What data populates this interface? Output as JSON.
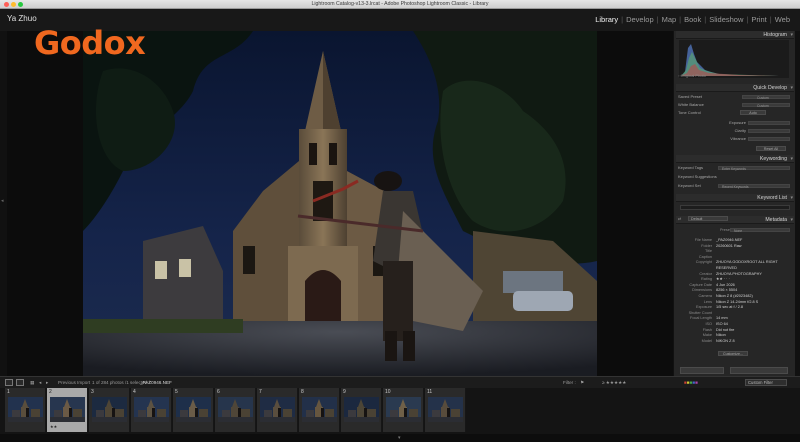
{
  "window": {
    "title": "Lightroom Catalog-v13-3.lrcat - Adobe Photoshop Lightroom Classic - Library"
  },
  "identity": {
    "name": "Ya Zhuo"
  },
  "modules": [
    "Library",
    "Develop",
    "Map",
    "Book",
    "Slideshow",
    "Print",
    "Web"
  ],
  "active_module": "Library",
  "logo": {
    "text": "Godox",
    "color": "#f0681f"
  },
  "right_panel": {
    "histogram": {
      "title": "Histogram",
      "original_photo_label": "Original Photo"
    },
    "quick_develop": {
      "title": "Quick Develop",
      "rows": [
        {
          "label": "Saved Preset",
          "value": "Custom"
        },
        {
          "label": "White Balance",
          "value": "Custom"
        },
        {
          "label": "Tone Control",
          "value": "Auto"
        },
        {
          "label": "Exposure",
          "value": ""
        },
        {
          "label": "Clarity",
          "value": ""
        },
        {
          "label": "Vibrance",
          "value": ""
        }
      ],
      "reset_label": "Reset All"
    },
    "keywording": {
      "title": "Keywording",
      "rows": [
        {
          "label": "Keyword Tags",
          "value": "Enter Keywords"
        },
        {
          "label": "Keyword Suggestions",
          "value": ""
        },
        {
          "label": "Keyword Set",
          "value": "Recent Keywords"
        }
      ]
    },
    "keyword_list": {
      "title": "Keyword List"
    },
    "metadata": {
      "title": "Metadata",
      "preset_label": "Default",
      "preset_value": "None",
      "fields": [
        {
          "key": "File Name",
          "value": "_PAZ0946.NEF"
        },
        {
          "key": "Folder",
          "value": "20260601 Raw"
        },
        {
          "key": "Title",
          "value": ""
        },
        {
          "key": "Caption",
          "value": ""
        },
        {
          "key": "Copyright",
          "value": "ZHUOYA GODOXROOT ALL RIGHT"
        },
        {
          "key": "",
          "value": "RESERVED"
        },
        {
          "key": "Creator",
          "value": "ZHUOYA PHOTOGRAPHY"
        },
        {
          "key": "Rating",
          "value": "★★ · · ·"
        },
        {
          "key": "Capture Date",
          "value": "4 Jun 2026"
        },
        {
          "key": "Dimensions",
          "value": "8256 × 5504"
        },
        {
          "key": "Camera",
          "value": "Nikon Z 8 (#2023482)"
        },
        {
          "key": "Lens",
          "value": "Nikon Z 14-24mm f/2.8 S"
        },
        {
          "key": "Exposure",
          "value": "1/5 sec at f / 2.8"
        },
        {
          "key": "Shutter Count",
          "value": ""
        },
        {
          "key": "Focal Length",
          "value": "14 mm"
        },
        {
          "key": "ISO",
          "value": "ISO 64"
        },
        {
          "key": "Flash",
          "value": "Did not fire"
        },
        {
          "key": "Make",
          "value": "Nikon"
        },
        {
          "key": "Model",
          "value": "NIKON Z 8"
        }
      ],
      "customize_label": "Customize..."
    }
  },
  "filmstrip_bar": {
    "source": "Previous Import",
    "count": "1 of 284 photos /1 selected /",
    "filename": "_PAZ0946.NEF",
    "filter_label": "Filter :",
    "filter_value": "Custom Filter"
  },
  "filmstrip": {
    "cells": [
      "1",
      "2",
      "3",
      "4",
      "5",
      "6",
      "7",
      "8",
      "9",
      "10",
      "11"
    ],
    "selected_index": 1
  }
}
